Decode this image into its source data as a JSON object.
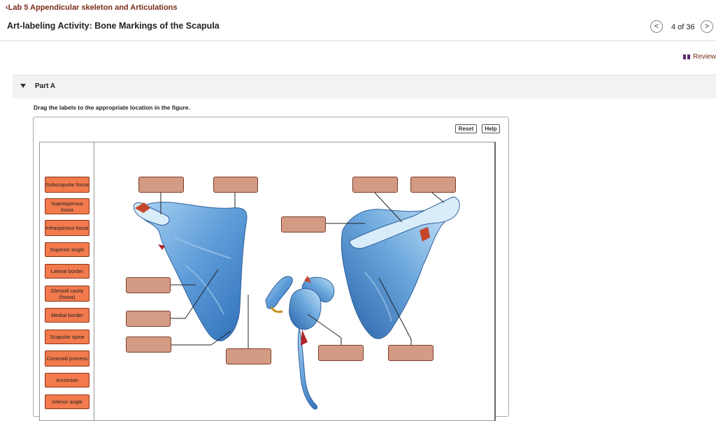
{
  "header": {
    "back_link": "Lab 5 Appendicular skeleton and Articulations",
    "title": "Art-labeling Activity: Bone Markings of the Scapula",
    "counter": "4 of 36",
    "review": "Review"
  },
  "part": {
    "label": "Part A",
    "instruction": "Drag the labels to the appropriate location in the figure."
  },
  "toolbar": {
    "reset": "Reset",
    "help": "Help"
  },
  "labels": [
    "Subscapular fossa",
    "Supraspinous fossa",
    "Infraspinous fossa",
    "Superior angle",
    "Lateral border",
    "Glenoid cavity (fossa)",
    "Medial border",
    "Scapular spine",
    "Coracoid process",
    "Acromion",
    "Inferior angle"
  ],
  "colors": {
    "label_fill": "#f27a4d",
    "target_fill": "#d49b84",
    "bone": "#6aa6dc",
    "accent_link": "#7a2a19"
  }
}
